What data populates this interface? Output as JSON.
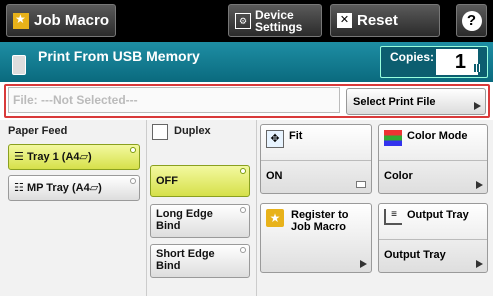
{
  "topbar": {
    "job_macro": "Job Macro",
    "device_settings_line1": "Device",
    "device_settings_line2": "Settings",
    "reset": "Reset",
    "help": "?"
  },
  "header": {
    "title": "Print From USB Memory",
    "copies_label": "Copies:",
    "copies_value": "1"
  },
  "file": {
    "field": "File: ---Not Selected---",
    "select_button": "Select Print File"
  },
  "paper_feed": {
    "label": "Paper Feed",
    "options": [
      "Tray 1 (A4▱)",
      "MP Tray (A4▱)"
    ]
  },
  "duplex": {
    "label": "Duplex",
    "options": [
      "OFF",
      "Long Edge Bind",
      "Short Edge Bind"
    ]
  },
  "fit": {
    "title": "Fit",
    "value": "ON"
  },
  "color_mode": {
    "title": "Color Mode",
    "value": "Color"
  },
  "register": {
    "title_line1": "Register to",
    "title_line2": "Job Macro"
  },
  "output_tray": {
    "title": "Output Tray",
    "value": "Output Tray"
  },
  "colors": {
    "topbar": "#000000",
    "teal": "#0f7b91",
    "selected": "#dde655",
    "error_border": "#d93a3a"
  }
}
